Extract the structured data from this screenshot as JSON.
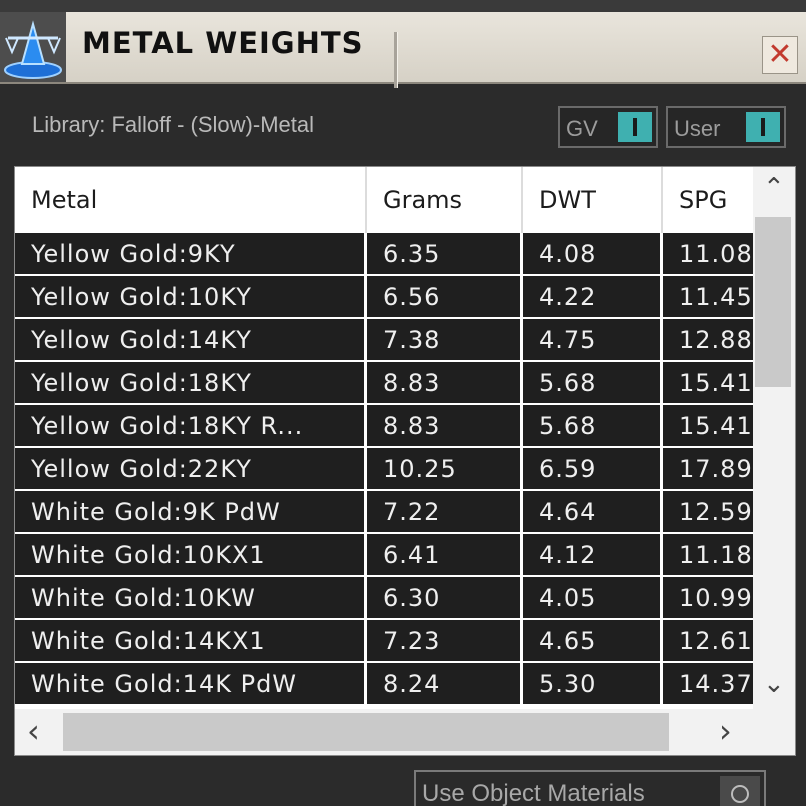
{
  "window": {
    "title": "METAL WEIGHTS",
    "close_glyph": "✕",
    "logo_icon": "scale-icon"
  },
  "library": {
    "label": "Library: Falloff - (Slow)-Metal"
  },
  "toggles": {
    "gv": {
      "label": "GV",
      "state": "on",
      "color": "#3fb0b0"
    },
    "user": {
      "label": "User",
      "state": "on",
      "color": "#3fb0b0"
    }
  },
  "table": {
    "columns": [
      "Metal",
      "Grams",
      "DWT",
      "SPG"
    ],
    "rows": [
      {
        "metal": "Yellow Gold:9KY",
        "grams": "6.35",
        "dwt": "4.08",
        "spg": "11.08"
      },
      {
        "metal": "Yellow Gold:10KY",
        "grams": "6.56",
        "dwt": "4.22",
        "spg": "11.45"
      },
      {
        "metal": "Yellow Gold:14KY",
        "grams": "7.38",
        "dwt": "4.75",
        "spg": "12.88"
      },
      {
        "metal": "Yellow Gold:18KY",
        "grams": "8.83",
        "dwt": "5.68",
        "spg": "15.41"
      },
      {
        "metal": "Yellow Gold:18KY R...",
        "grams": "8.83",
        "dwt": "5.68",
        "spg": "15.41"
      },
      {
        "metal": "Yellow Gold:22KY",
        "grams": "10.25",
        "dwt": "6.59",
        "spg": "17.89"
      },
      {
        "metal": "White Gold:9K PdW",
        "grams": "7.22",
        "dwt": "4.64",
        "spg": "12.59"
      },
      {
        "metal": "White Gold:10KX1",
        "grams": "6.41",
        "dwt": "4.12",
        "spg": "11.18"
      },
      {
        "metal": "White Gold:10KW",
        "grams": "6.30",
        "dwt": "4.05",
        "spg": "10.99"
      },
      {
        "metal": "White Gold:14KX1",
        "grams": "7.23",
        "dwt": "4.65",
        "spg": "12.61"
      },
      {
        "metal": "White Gold:14K PdW",
        "grams": "8.24",
        "dwt": "5.30",
        "spg": "14.37"
      }
    ],
    "scroll": {
      "up": "⌃",
      "down": "⌄",
      "left": "‹",
      "right": "›"
    }
  },
  "footer": {
    "use_object_materials_label": "Use Object Materials"
  }
}
